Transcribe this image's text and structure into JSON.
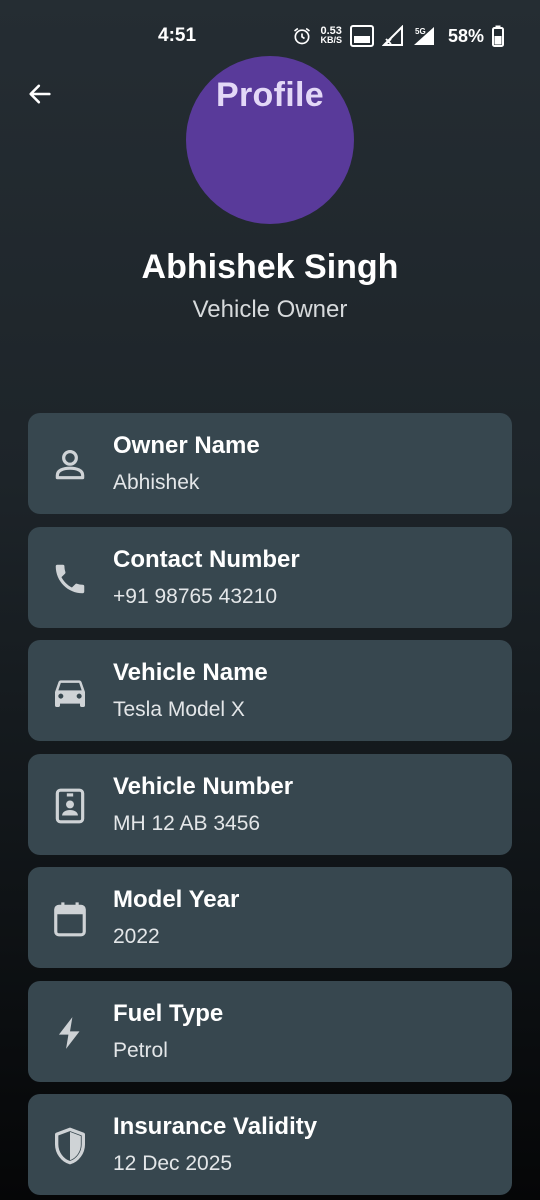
{
  "status_bar": {
    "time": "4:51",
    "speed_value": "0.53",
    "speed_unit": "KB/S",
    "network": "5G",
    "battery": "58%"
  },
  "header": {
    "title": "Profile",
    "avatar_color": "#593a9a"
  },
  "profile": {
    "name": "Abhishek Singh",
    "role": "Vehicle Owner"
  },
  "details": [
    {
      "icon": "person-icon",
      "label": "Owner Name",
      "value": "Abhishek"
    },
    {
      "icon": "phone-icon",
      "label": "Contact Number",
      "value": "+91 98765 43210"
    },
    {
      "icon": "car-icon",
      "label": "Vehicle Name",
      "value": "Tesla Model X"
    },
    {
      "icon": "badge-icon",
      "label": "Vehicle Number",
      "value": "MH 12 AB 3456"
    },
    {
      "icon": "calendar-icon",
      "label": "Model Year",
      "value": "2022"
    },
    {
      "icon": "bolt-icon",
      "label": "Fuel Type",
      "value": "Petrol"
    },
    {
      "icon": "shield-icon",
      "label": "Insurance Validity",
      "value": "12 Dec 2025"
    }
  ],
  "colors": {
    "card_background": "#37474f",
    "background_top": "#252d33",
    "background_bottom": "#050607"
  }
}
